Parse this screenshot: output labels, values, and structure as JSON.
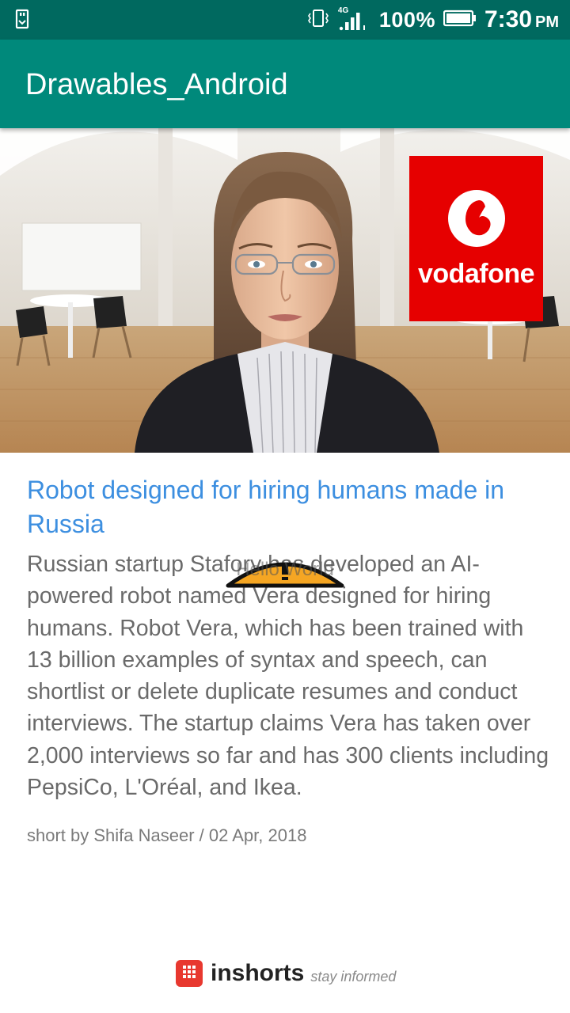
{
  "status_bar": {
    "network": "4G",
    "battery_percent": "100%",
    "time": "7:30",
    "ampm": "PM"
  },
  "app_bar": {
    "title": "Drawables_Android"
  },
  "hero": {
    "logo_text": "vodafone",
    "logo_color": "#e60000"
  },
  "article": {
    "headline": "Robot designed for hiring humans made in Russia",
    "body": "Russian startup Stafory has developed an AI-powered robot named Vera designed for hiring humans. Robot Vera, which has been trained with 13 billion examples of syntax and speech, can shortlist or delete duplicate resumes and conduct interviews. The startup claims Vera has taken over 2,000 interviews so far and has 300 clients including PepsiCo, L'Oréal, and Ikea.",
    "byline": "short by Shifa Naseer / 02 Apr, 2018"
  },
  "overlay": {
    "text": "Hello World"
  },
  "footer": {
    "brand": "inshorts",
    "tagline": "stay informed"
  },
  "colors": {
    "status_bar": "#00695f",
    "app_bar": "#00897b",
    "headline": "#3d8fe0",
    "body": "#6a6a6a"
  }
}
